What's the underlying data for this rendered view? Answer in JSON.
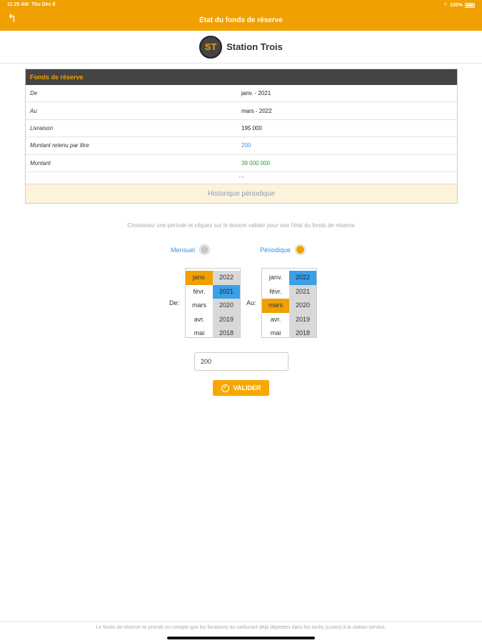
{
  "status": {
    "time": "11:25 AM",
    "date": "Thu Dec 8",
    "battery": "100%"
  },
  "nav": {
    "title": "État du fonds de réserve",
    "back_icon": "back-arrow-icon"
  },
  "brand": {
    "logo_text": "ST",
    "name": "Station Trois"
  },
  "table": {
    "title": "Fonds de réserve",
    "rows": [
      {
        "label": "De",
        "value": "janv. - 2021"
      },
      {
        "label": "Au",
        "value": "mars - 2022"
      },
      {
        "label": "Livraison",
        "value": "195 000"
      },
      {
        "label": "Montant retenu par litre",
        "value": "200"
      },
      {
        "label": "Montant",
        "value": "39 000 000"
      }
    ],
    "dots": "• •",
    "history_button": "Historique périodique"
  },
  "hint": "Choisissez une période et cliquez sur le bouton valider pour voir l'état du fonds de réserve",
  "mode": {
    "monthly_label": "Mensuel",
    "periodic_label": "Périodique",
    "selected": "Périodique"
  },
  "from_label": "De:",
  "to_label": "Au:",
  "picker_from": {
    "months": [
      "janv.",
      "févr.",
      "mars",
      "avr.",
      "mai"
    ],
    "years": [
      "2022",
      "2021",
      "2020",
      "2019",
      "2018"
    ],
    "selected_month": "janv.",
    "selected_year": "2021"
  },
  "picker_to": {
    "months": [
      "janv.",
      "févr.",
      "mars",
      "avr.",
      "mai"
    ],
    "years": [
      "2022",
      "2021",
      "2020",
      "2019",
      "2018"
    ],
    "selected_month": "mars",
    "selected_year": "2022"
  },
  "amount_input": {
    "value": "200"
  },
  "validate_button": "VALIDER",
  "footer": "Le fonds de réserve ne prends en compte que les livraisons en carburant déjà dépotées dans les tanks (cuves) à la station-service.",
  "colors": {
    "accent": "#f0a000",
    "header_dark": "#444444",
    "blue": "#3aa0ea",
    "green": "#2e9a3a"
  }
}
